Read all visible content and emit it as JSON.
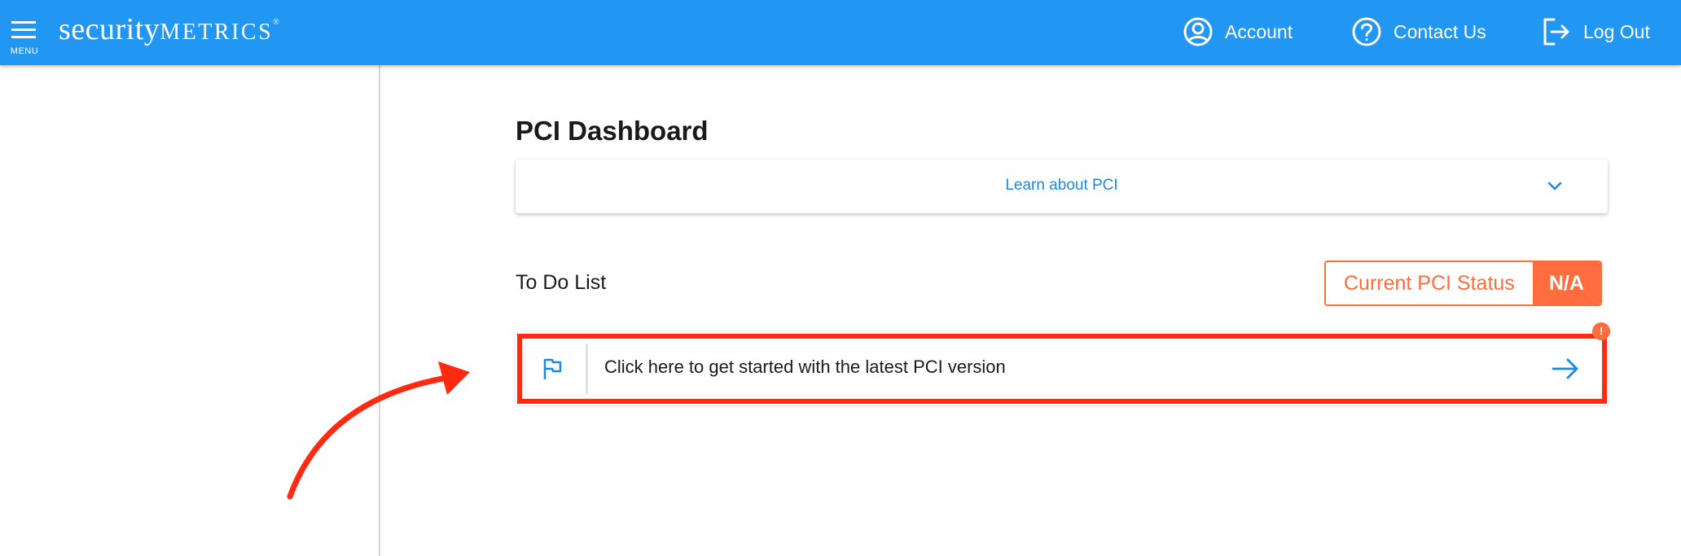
{
  "header": {
    "menu_label": "MENU",
    "logo": {
      "part1": "security",
      "part2": "METRICS",
      "mark": "®"
    },
    "nav": {
      "account": "Account",
      "contact": "Contact Us",
      "logout": "Log Out"
    },
    "icons": {
      "menu": "hamburger-icon",
      "account": "account-circle-icon",
      "contact": "help-circle-icon",
      "logout": "logout-icon"
    }
  },
  "main": {
    "title": "PCI Dashboard",
    "learn_panel": {
      "label": "Learn about PCI",
      "icon": "chevron-down-icon"
    },
    "todo": {
      "heading": "To Do List",
      "items": [
        {
          "text": "Click here to get started with the latest PCI version",
          "leading_icon": "flag-icon",
          "trailing_icon": "arrow-right-icon",
          "notification": "!"
        }
      ]
    },
    "status": {
      "label": "Current PCI Status",
      "value": "N/A"
    }
  },
  "colors": {
    "topbar": "#2196f3",
    "link": "#1e88e5",
    "status_accent": "#ff6d3f",
    "annotation": "#ff2a10"
  }
}
